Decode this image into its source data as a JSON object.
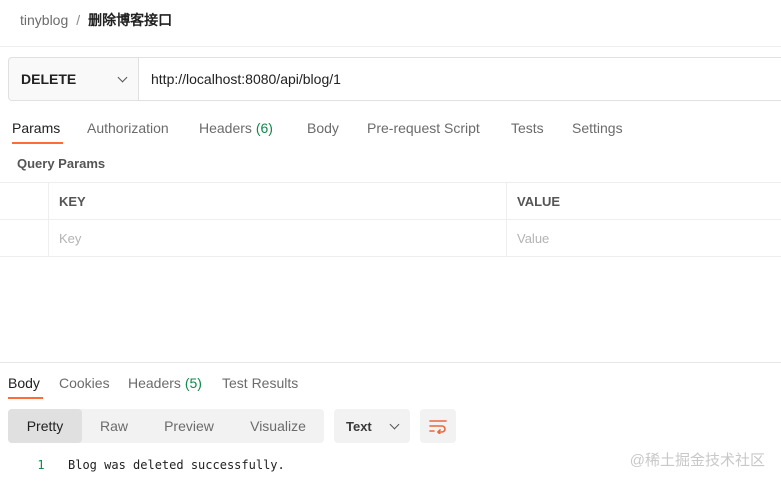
{
  "breadcrumb": {
    "parent": "tinyblog",
    "separator": "/",
    "current": "删除博客接口"
  },
  "request": {
    "method": "DELETE",
    "url": "http://localhost:8080/api/blog/1"
  },
  "request_tabs": [
    {
      "label": "Params",
      "count": "",
      "active": true
    },
    {
      "label": "Authorization",
      "count": "",
      "active": false
    },
    {
      "label": "Headers",
      "count": "(6)",
      "active": false
    },
    {
      "label": "Body",
      "count": "",
      "active": false
    },
    {
      "label": "Pre-request Script",
      "count": "",
      "active": false
    },
    {
      "label": "Tests",
      "count": "",
      "active": false
    },
    {
      "label": "Settings",
      "count": "",
      "active": false
    }
  ],
  "query_params": {
    "title": "Query Params",
    "columns": {
      "key": "KEY",
      "value": "VALUE"
    },
    "placeholders": {
      "key": "Key",
      "value": "Value"
    }
  },
  "response_tabs": [
    {
      "label": "Body",
      "count": "",
      "active": true
    },
    {
      "label": "Cookies",
      "count": "",
      "active": false
    },
    {
      "label": "Headers",
      "count": "(5)",
      "active": false
    },
    {
      "label": "Test Results",
      "count": "",
      "active": false
    }
  ],
  "view_modes": [
    {
      "label": "Pretty",
      "active": true
    },
    {
      "label": "Raw",
      "active": false
    },
    {
      "label": "Preview",
      "active": false
    },
    {
      "label": "Visualize",
      "active": false
    }
  ],
  "format": {
    "selected": "Text"
  },
  "response_body": [
    {
      "line": "1",
      "text": "Blog was deleted successfully."
    }
  ],
  "icons": {
    "format_chevron": "chevron-down-icon",
    "wrap": "wrap-lines-icon"
  },
  "colors": {
    "accent": "#ff6c37",
    "count_green": "#0f8a4a"
  },
  "watermark": "@稀土掘金技术社区"
}
